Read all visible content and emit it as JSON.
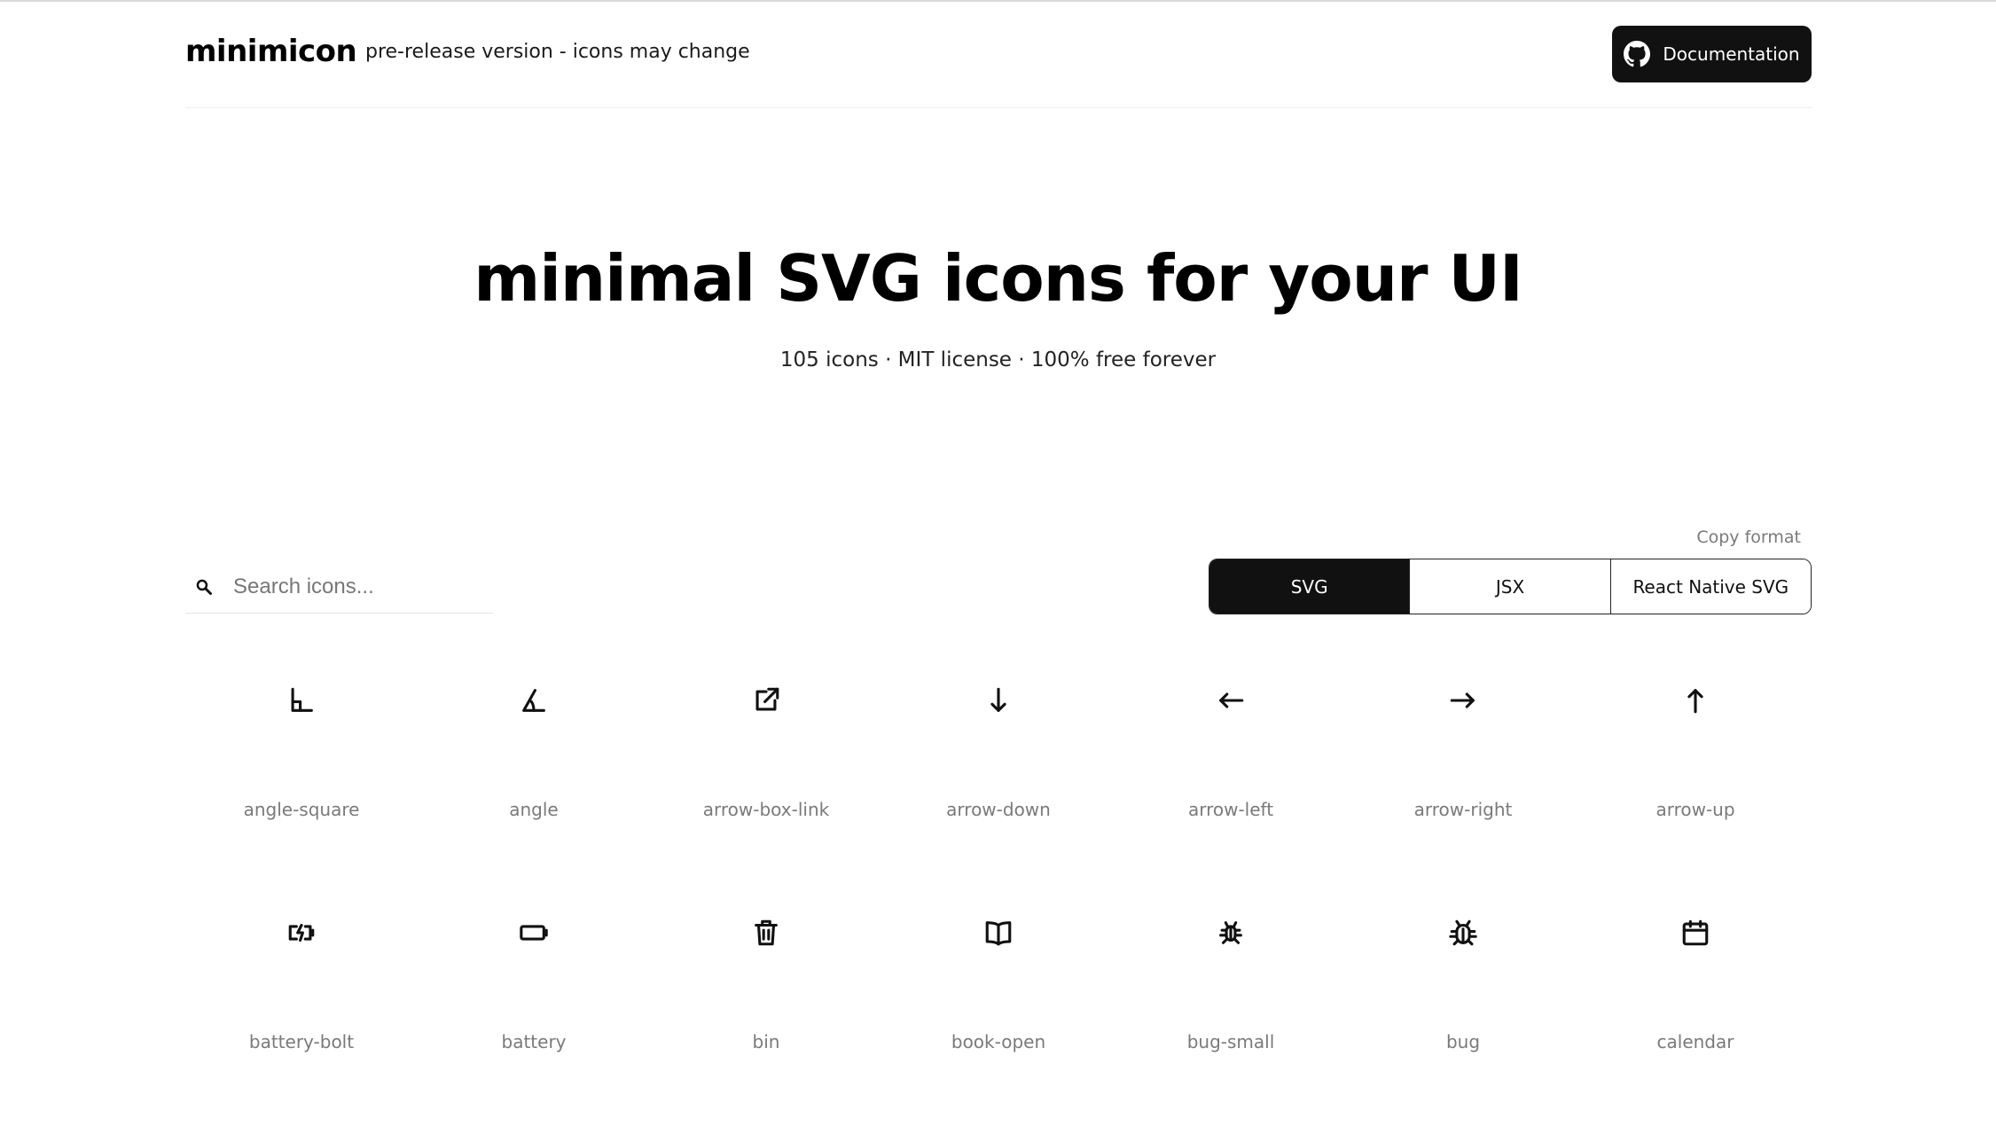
{
  "header": {
    "brand": "minimicon",
    "tagline": "pre-release version - icons may change",
    "doc_button": {
      "label": "Documentation",
      "icon": "github-icon"
    }
  },
  "hero": {
    "title": "minimal SVG icons for your UI",
    "subtitle": "105 icons · MIT license · 100% free forever"
  },
  "search": {
    "placeholder": "Search icons...",
    "value": "",
    "icon": "search-icon"
  },
  "copy_format": {
    "label": "Copy format",
    "options": [
      "SVG",
      "JSX",
      "React Native SVG"
    ],
    "selected": "SVG"
  },
  "icons": [
    {
      "name": "angle-square"
    },
    {
      "name": "angle"
    },
    {
      "name": "arrow-box-link"
    },
    {
      "name": "arrow-down"
    },
    {
      "name": "arrow-left"
    },
    {
      "name": "arrow-right"
    },
    {
      "name": "arrow-up"
    },
    {
      "name": "battery-bolt"
    },
    {
      "name": "battery"
    },
    {
      "name": "bin"
    },
    {
      "name": "book-open"
    },
    {
      "name": "bug-small"
    },
    {
      "name": "bug"
    },
    {
      "name": "calendar"
    }
  ],
  "colors": {
    "text": "#111111",
    "muted": "#7a7a7a",
    "accent": "#111111",
    "background": "#ffffff"
  }
}
